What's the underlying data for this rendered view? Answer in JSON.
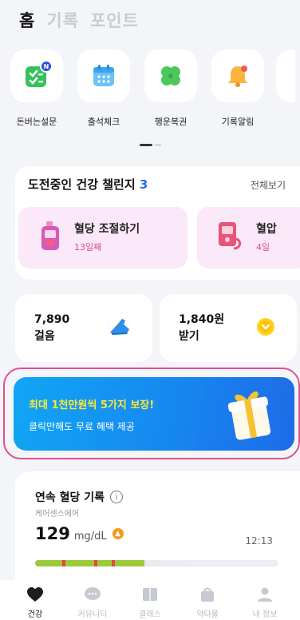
{
  "top_tabs": [
    {
      "label": "홈",
      "active": true
    },
    {
      "label": "기록",
      "active": false
    },
    {
      "label": "포인트",
      "active": false
    }
  ],
  "shortcuts": [
    {
      "label": "돈버는설문",
      "icon": "survey-icon",
      "badge": "N"
    },
    {
      "label": "출석체크",
      "icon": "calendar-icon"
    },
    {
      "label": "행운복권",
      "icon": "clover-icon"
    },
    {
      "label": "기록알림",
      "icon": "bell-icon"
    }
  ],
  "challenge": {
    "title": "도전중인 건강 챌린지",
    "count": "3",
    "see_all": "전체보기",
    "items": [
      {
        "name": "혈당 조절하기",
        "days": "13일째",
        "icon": "glucose-meter-icon"
      },
      {
        "name": "혈압",
        "days": "4일",
        "icon": "blood-pressure-icon"
      }
    ]
  },
  "stats": {
    "steps": {
      "line1": "7,890",
      "line2": "걸음",
      "icon": "sneaker-icon"
    },
    "points": {
      "line1": "1,840원",
      "line2": "받기",
      "icon": "coin-icon"
    }
  },
  "promo": {
    "headline": "최대 1천만원씩 5가지 보장!",
    "sub": "클릭만해도 무료 혜택 제공",
    "icon": "gift-box-icon"
  },
  "record": {
    "title": "연속 혈당 기록",
    "device": "케어센스에어",
    "value": "129",
    "unit": "mg/dL",
    "time": "12:13",
    "range_fill_fraction": 0.45
  },
  "bottom_nav": [
    {
      "label": "건강",
      "icon": "heart-icon",
      "active": true
    },
    {
      "label": "커뮤니티",
      "icon": "chat-icon",
      "active": false
    },
    {
      "label": "클래스",
      "icon": "book-icon",
      "active": false
    },
    {
      "label": "약타몰",
      "icon": "shopping-bag-icon",
      "active": false
    },
    {
      "label": "내 정보",
      "icon": "person-icon",
      "active": false
    }
  ],
  "colors": {
    "accent_blue": "#2b6de8",
    "challenge_pink": "#e04b9a",
    "promo_yellow": "#ffe833",
    "glucose_green": "#9dca3c"
  }
}
